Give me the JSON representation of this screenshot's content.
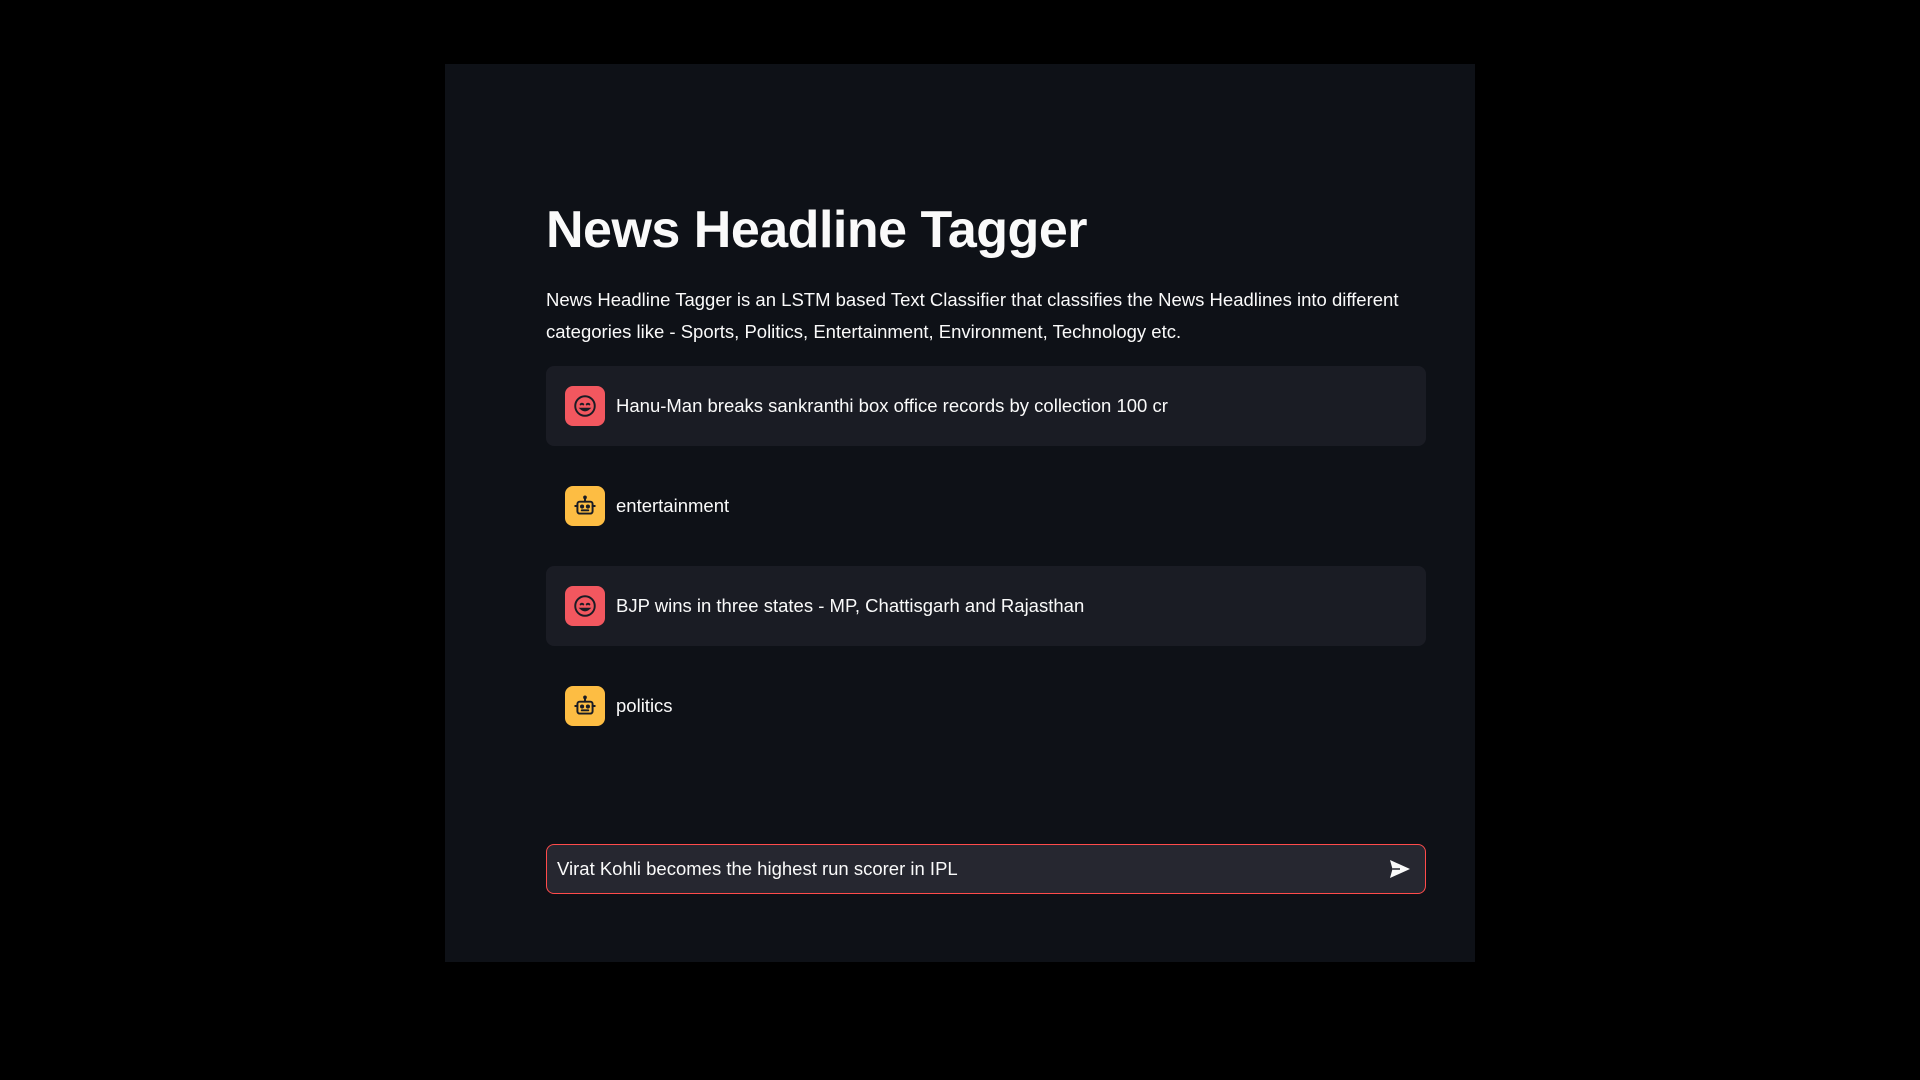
{
  "page": {
    "title": "News Headline Tagger",
    "description": "News Headline Tagger is an LSTM based Text Classifier that classifies the News Headlines into different categories like - Sports, Politics, Entertainment, Environment, Technology etc."
  },
  "chat": {
    "messages": [
      {
        "role": "user",
        "avatar_icon": "smiley-face-icon",
        "text": "Hanu-Man breaks sankranthi box office records by collection 100 cr"
      },
      {
        "role": "assistant",
        "avatar_icon": "robot-icon",
        "text": "entertainment"
      },
      {
        "role": "user",
        "avatar_icon": "smiley-face-icon",
        "text": "BJP wins in three states - MP, Chattisgarh and Rajasthan"
      },
      {
        "role": "assistant",
        "avatar_icon": "robot-icon",
        "text": "politics"
      }
    ],
    "input": {
      "value": "Virat Kohli becomes the highest run scorer in IPL",
      "send_icon": "send-icon"
    }
  },
  "colors": {
    "background": "#0e1117",
    "user_message_bg": "#1a1c24",
    "user_avatar": "#f2575f",
    "bot_avatar": "#fdbd43",
    "input_border": "#ff4b4b",
    "input_bg": "#262730",
    "text": "#fafafa"
  }
}
